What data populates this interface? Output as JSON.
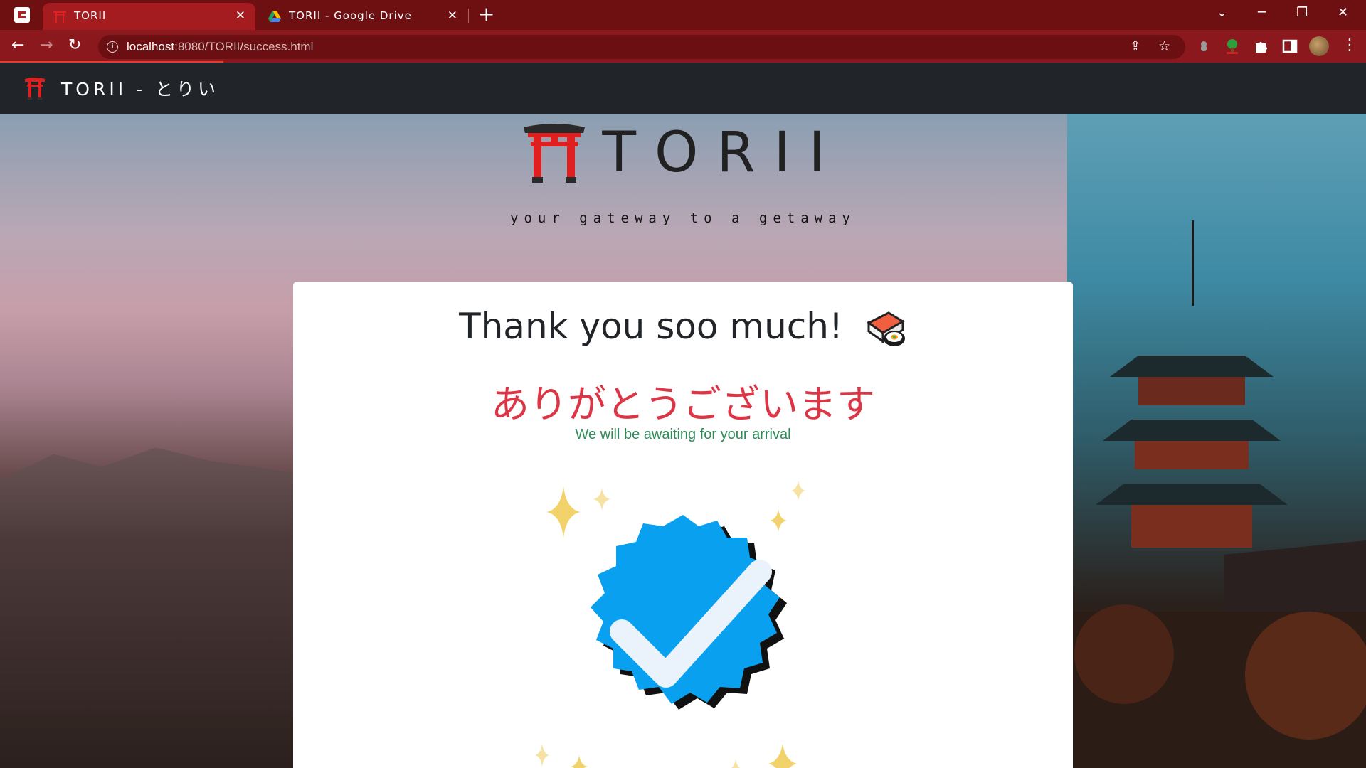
{
  "browser": {
    "tabs": [
      {
        "title": "TORII",
        "active": true
      },
      {
        "title": "TORII - Google Drive",
        "active": false
      }
    ],
    "url_host": "localhost",
    "url_path": ":8080/TORII/success.html"
  },
  "navbar": {
    "brand": "TORII - とりい"
  },
  "hero": {
    "logo_text": "TORII",
    "tagline": "your gateway to a getaway"
  },
  "card": {
    "title": "Thank you soo much!",
    "japanese": "ありがとうございます",
    "subtitle": "We will be awaiting for your arrival"
  },
  "colors": {
    "chrome_tabstrip": "#6e0f12",
    "chrome_toolbar": "#8b181c",
    "navbar": "#212529",
    "torii_red": "#e02020",
    "japanese_text": "#dc3545",
    "subtitle_text": "#2e8b57",
    "badge_blue": "#0aa0f0"
  },
  "icons": [
    "torii-gate-icon",
    "sushi-icon",
    "verified-check-icon",
    "sparkle-icon",
    "google-drive-icon"
  ]
}
